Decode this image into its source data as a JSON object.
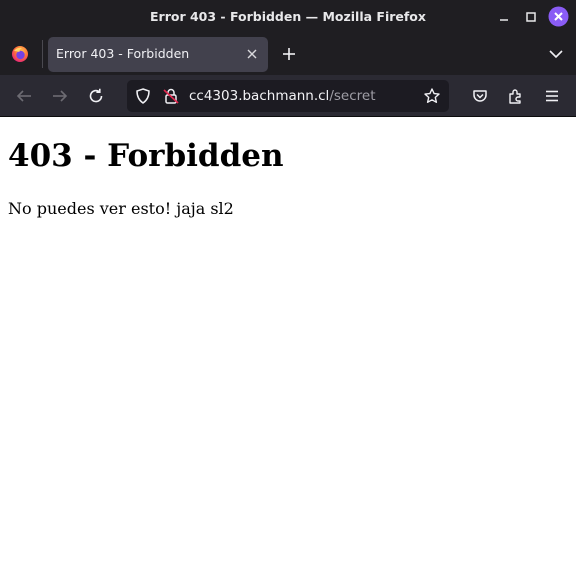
{
  "window": {
    "title": "Error 403 - Forbidden — Mozilla Firefox"
  },
  "tabs": [
    {
      "label": "Error 403 - Forbidden",
      "active": true
    }
  ],
  "navbar": {
    "url_host": "cc4303.bachmann.cl",
    "url_path": "/secret",
    "back_enabled": false,
    "forward_enabled": false
  },
  "page": {
    "heading": "403 - Forbidden",
    "message": "No puedes ver esto! jaja sl2"
  },
  "icons": {
    "window": [
      "minimize-icon",
      "maximize-icon",
      "close-icon"
    ],
    "tabstrip": [
      "firefox-logo-icon",
      "tab-close-icon",
      "new-tab-icon",
      "tab-list-chevron-icon"
    ],
    "navbar": [
      "back-arrow-icon",
      "forward-arrow-icon",
      "reload-icon",
      "tracking-shield-icon",
      "insecure-lock-icon",
      "bookmark-star-icon",
      "pocket-icon",
      "extensions-icon",
      "menu-icon"
    ]
  },
  "colors": {
    "chrome_dark": "#1f1e22",
    "active_tab": "#42414d",
    "navbar": "#2b2a33",
    "urlbar": "#1c1b22",
    "close_button": "#8a5cf5",
    "insecure_lock_slash": "#e22850"
  }
}
